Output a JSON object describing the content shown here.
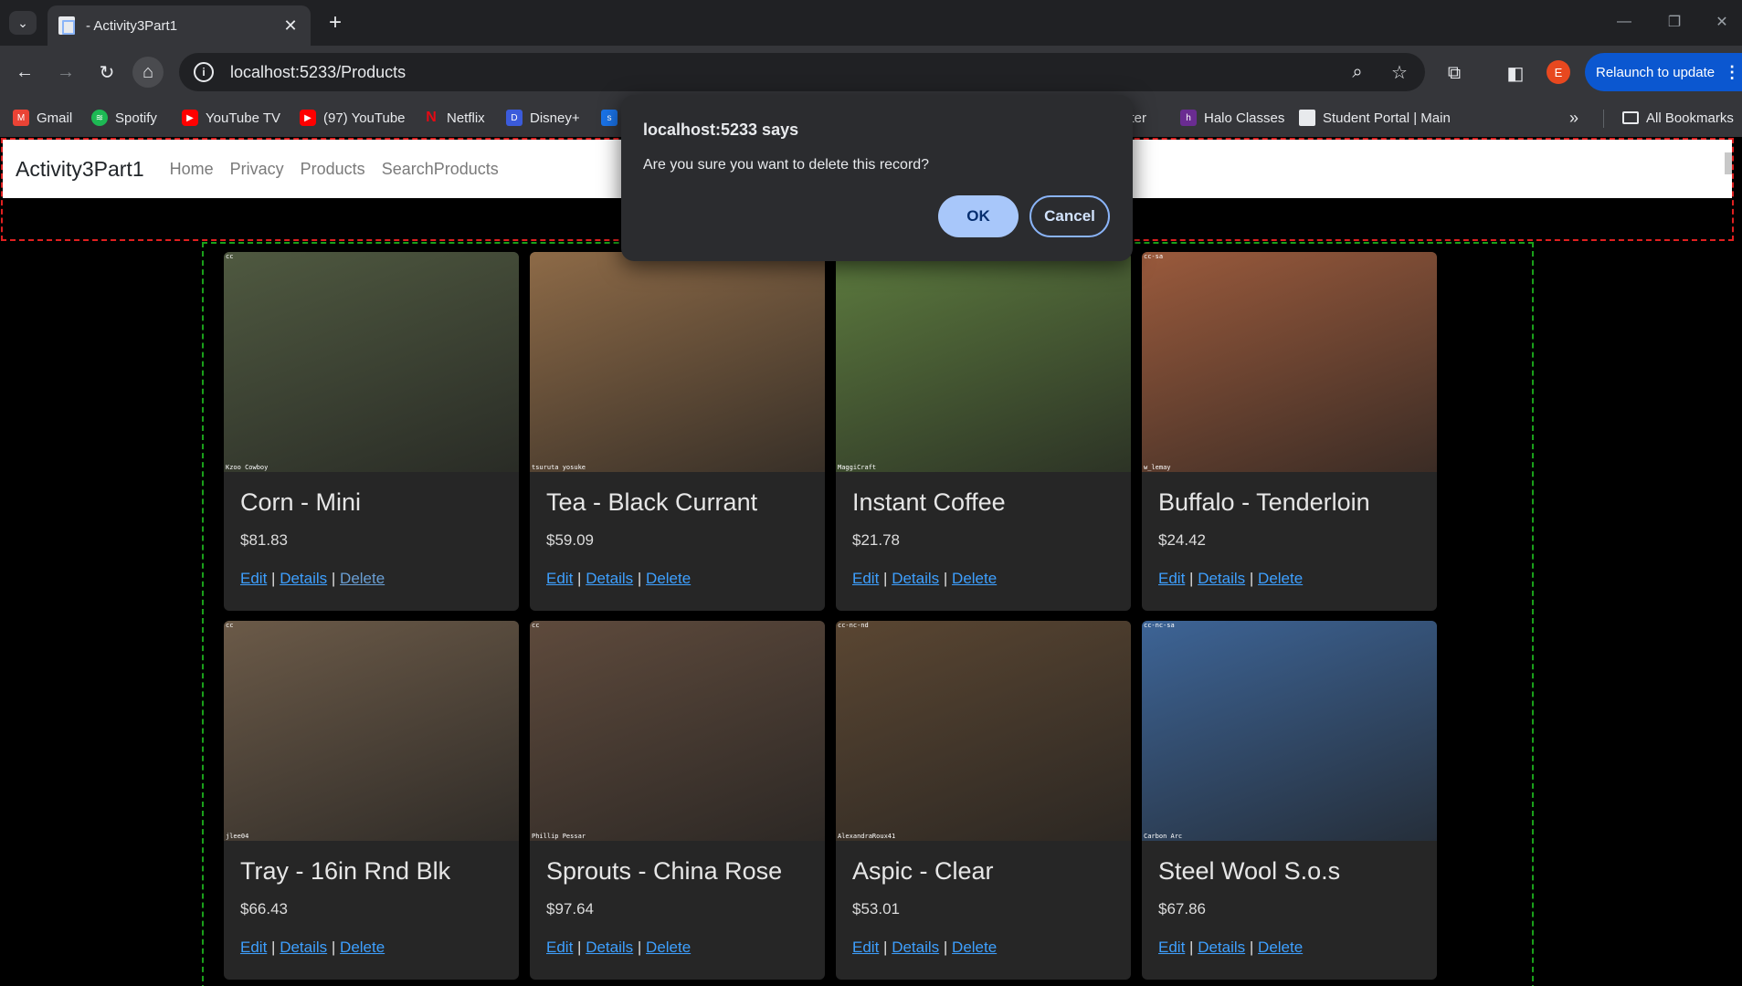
{
  "browser": {
    "tab_title": "- Activity3Part1",
    "url": "localhost:5233/Products",
    "relaunch_label": "Relaunch to update",
    "avatar_letter": "E",
    "all_bookmarks_label": "All Bookmarks",
    "bookmarks": [
      {
        "label": "Gmail",
        "icon": "gmail-icon",
        "color": "#ea4335"
      },
      {
        "label": "Spotify",
        "icon": "spotify-icon",
        "color": "#1db954"
      },
      {
        "label": "YouTube TV",
        "icon": "youtube-tv-icon",
        "color": "#ff0000"
      },
      {
        "label": "(97) YouTube",
        "icon": "youtube-icon",
        "color": "#ff0000"
      },
      {
        "label": "Netflix",
        "icon": "netflix-icon",
        "color": "#e50914"
      },
      {
        "label": "Disney+",
        "icon": "disney-icon",
        "color": "#3b5bdb"
      },
      {
        "label": "itter",
        "icon": "twitter-icon",
        "color": "#1d9bf0"
      },
      {
        "label": "Halo Classes",
        "icon": "halo-icon",
        "color": "#6a2c91"
      },
      {
        "label": "Student Portal | Main",
        "icon": "portal-icon",
        "color": "#e8eaed"
      }
    ]
  },
  "dialog": {
    "title": "localhost:5233 says",
    "message": "Are you sure you want to delete this record?",
    "ok_label": "OK",
    "cancel_label": "Cancel"
  },
  "site": {
    "brand": "Activity3Part1",
    "nav": [
      "Home",
      "Privacy",
      "Products",
      "SearchProducts"
    ]
  },
  "action_labels": {
    "edit": "Edit",
    "details": "Details",
    "delete": "Delete",
    "sep": "|"
  },
  "products": [
    {
      "name": "Corn - Mini",
      "price": "$81.83",
      "license": "cc",
      "credit": "Kzoo Cowboy",
      "img_color": "#4f5940"
    },
    {
      "name": "Tea - Black Currant",
      "price": "$59.09",
      "license": "",
      "credit": "tsuruta yosuke",
      "img_color": "#8d6a47"
    },
    {
      "name": "Instant Coffee",
      "price": "$21.78",
      "license": "",
      "credit": "MaggiCraft",
      "img_color": "#5c7a3e"
    },
    {
      "name": "Buffalo - Tenderloin",
      "price": "$24.42",
      "license": "cc-sa",
      "credit": "w_lemay",
      "img_color": "#9a5a3c"
    },
    {
      "name": "Tray - 16in Rnd Blk",
      "price": "$66.43",
      "license": "cc",
      "credit": "jlee04",
      "img_color": "#6b5a48"
    },
    {
      "name": "Sprouts - China Rose",
      "price": "$97.64",
      "license": "cc",
      "credit": "Phillip Pessar",
      "img_color": "#5e4a3c"
    },
    {
      "name": "Aspic - Clear",
      "price": "$53.01",
      "license": "cc-nc-nd",
      "credit": "AlexandraRoux41",
      "img_color": "#5a4632"
    },
    {
      "name": "Steel Wool S.o.s",
      "price": "$67.86",
      "license": "cc-nc-sa",
      "credit": "Carbon Arc",
      "img_color": "#3d6496"
    }
  ]
}
